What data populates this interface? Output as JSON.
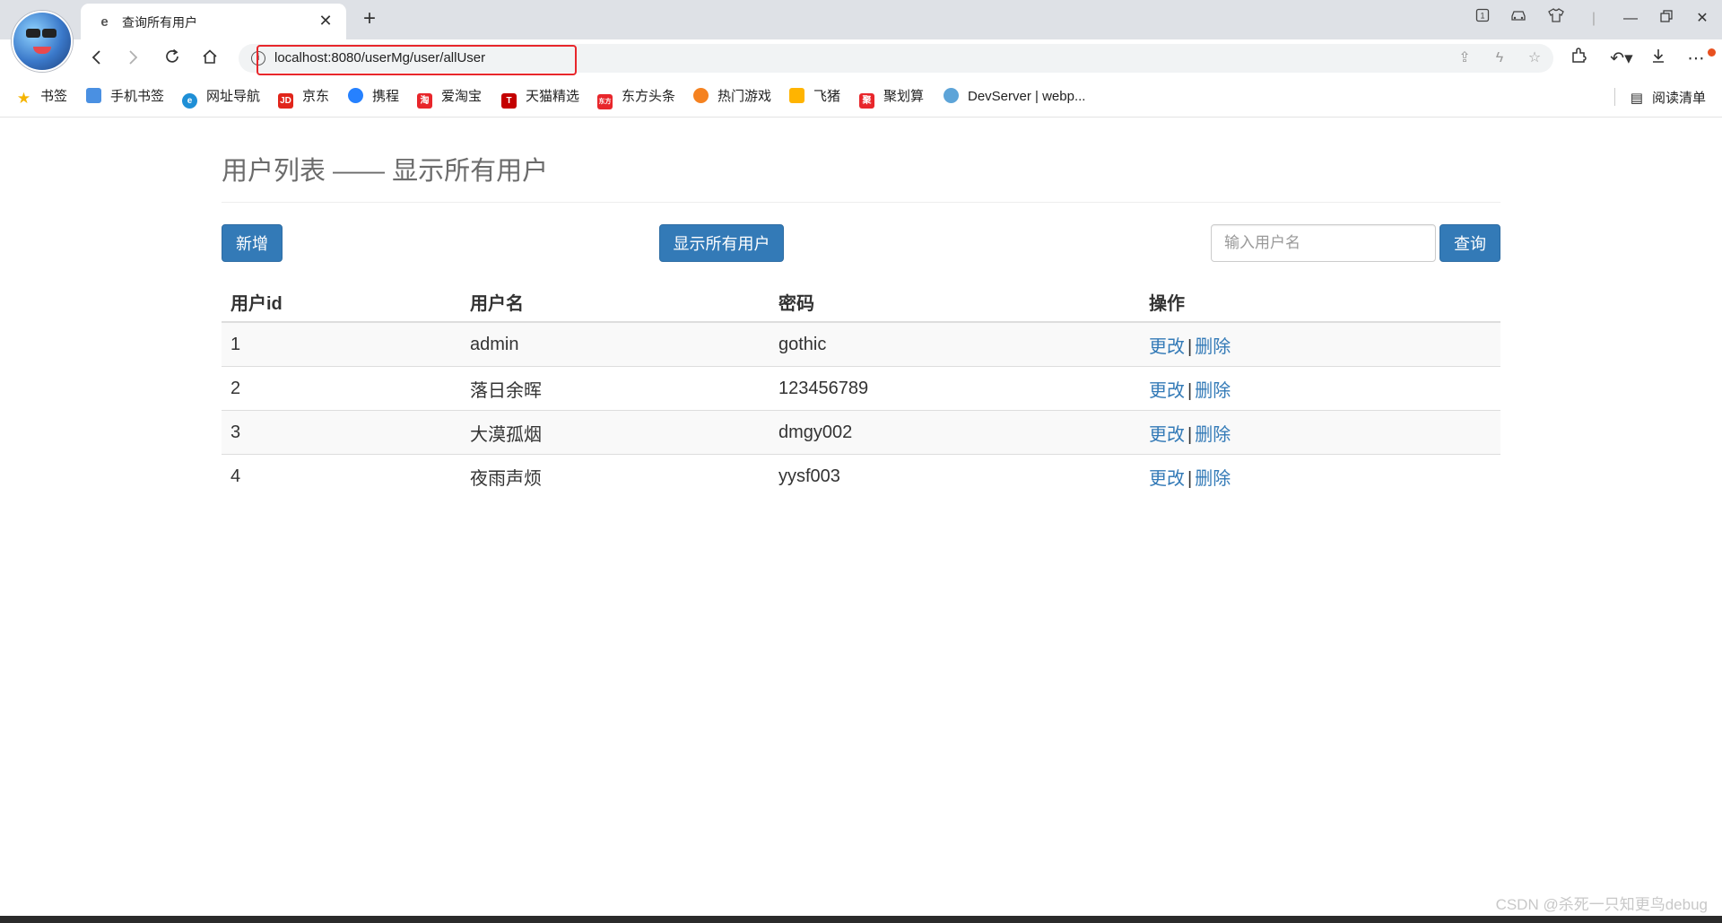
{
  "browser": {
    "tab_title": "查询所有用户",
    "url": "localhost:8080/userMg/user/allUser",
    "bookmarks": [
      {
        "label": "书签",
        "icon": "star-icon",
        "color": "#f5b400"
      },
      {
        "label": "手机书签",
        "icon": "phone-bookmark-icon",
        "color": "#4a90e2"
      },
      {
        "label": "网址导航",
        "icon": "nav-icon",
        "color": "#1f8fd6"
      },
      {
        "label": "京东",
        "icon": "jd-icon",
        "color": "#e1251b"
      },
      {
        "label": "携程",
        "icon": "ctrip-icon",
        "color": "#2681ff"
      },
      {
        "label": "爱淘宝",
        "icon": "taobao-icon",
        "color": "#e8262b"
      },
      {
        "label": "天猫精选",
        "icon": "tmall-icon",
        "color": "#c40000"
      },
      {
        "label": "东方头条",
        "icon": "toutiao-icon",
        "color": "#e8262b"
      },
      {
        "label": "热门游戏",
        "icon": "game-icon",
        "color": "#f58220"
      },
      {
        "label": "飞猪",
        "icon": "fliggy-icon",
        "color": "#ffb400"
      },
      {
        "label": "聚划算",
        "icon": "juhuasuan-icon",
        "color": "#e8262b"
      },
      {
        "label": "DevServer | webp...",
        "icon": "webpack-icon",
        "color": "#5da4d8"
      }
    ],
    "reading_list": "阅读清单"
  },
  "page": {
    "heading": "用户列表 —— 显示所有用户",
    "add_button": "新增",
    "show_all_button": "显示所有用户",
    "search_placeholder": "输入用户名",
    "search_button": "查询"
  },
  "table": {
    "headers": [
      "用户id",
      "用户名",
      "密码",
      "操作"
    ],
    "rows": [
      {
        "id": "1",
        "name": "admin",
        "password": "gothic"
      },
      {
        "id": "2",
        "name": "落日余晖",
        "password": "123456789"
      },
      {
        "id": "3",
        "name": "大漠孤烟",
        "password": "dmgy002"
      },
      {
        "id": "4",
        "name": "夜雨声烦",
        "password": "yysf003"
      }
    ],
    "edit_label": "更改",
    "separator": "|",
    "delete_label": "删除"
  },
  "watermark": "CSDN @杀死一只知更鸟debug",
  "colors": {
    "primary": "#337ab7",
    "highlight_border": "#e8262b"
  }
}
